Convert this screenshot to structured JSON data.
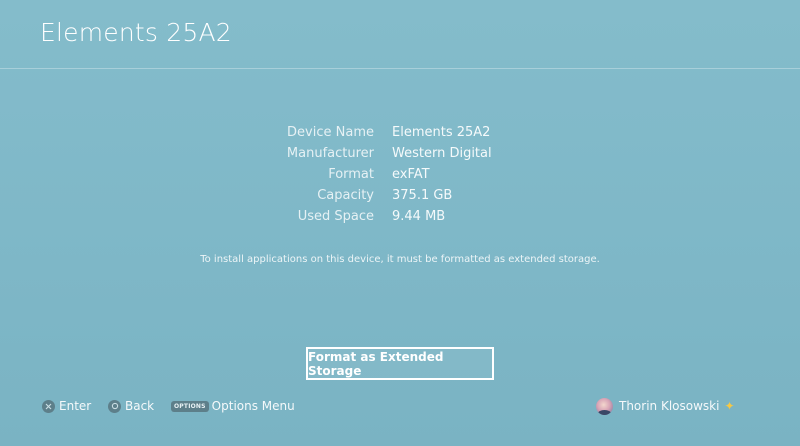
{
  "header": {
    "title": "Elements 25A2"
  },
  "device_info": [
    {
      "label": "Device Name",
      "value": "Elements 25A2"
    },
    {
      "label": "Manufacturer",
      "value": "Western Digital"
    },
    {
      "label": "Format",
      "value": "exFAT"
    },
    {
      "label": "Capacity",
      "value": "375.1 GB"
    },
    {
      "label": "Used Space",
      "value": "9.44 MB"
    }
  ],
  "notice": "To install applications on this device, it must be formatted as extended storage.",
  "format_button_label": "Format as Extended Storage",
  "footer": {
    "enter_label": "Enter",
    "back_label": "Back",
    "options_badge": "OPTIONS",
    "options_label": "Options Menu",
    "user_name": "Thorin Klosowski",
    "plus_icon": "✦"
  },
  "colors": {
    "background": "#7fb8c8",
    "text": "#ffffff",
    "button_glyph": "#5d7f8a",
    "plus_accent": "#f6c844"
  },
  "icons": {
    "enter": "cross-button-icon",
    "back": "circle-button-icon",
    "options": "options-button-icon",
    "plus": "playstation-plus-icon"
  }
}
